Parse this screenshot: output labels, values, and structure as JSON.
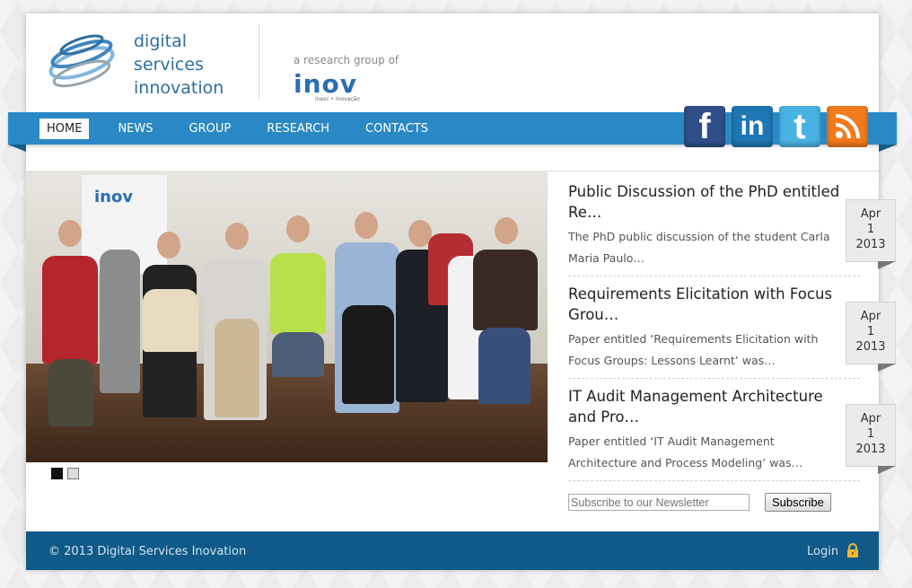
{
  "header": {
    "logo_lines": [
      "digital",
      "services",
      "innovation"
    ],
    "research_group_of": "a research group of",
    "partner_logo_main": "inov",
    "partner_logo_sub": "inesc • inovação"
  },
  "nav": {
    "items": [
      {
        "label": "HOME",
        "active": true
      },
      {
        "label": "NEWS",
        "active": false
      },
      {
        "label": "GROUP",
        "active": false
      },
      {
        "label": "RESEARCH",
        "active": false
      },
      {
        "label": "CONTACTS",
        "active": false
      }
    ]
  },
  "social": [
    {
      "name": "facebook-icon",
      "glyph": "f",
      "color": "#2e4f8a"
    },
    {
      "name": "linkedin-icon",
      "glyph": "in",
      "color": "#1e77b4"
    },
    {
      "name": "twitter-icon",
      "glyph": "t",
      "color": "#49b3e3"
    },
    {
      "name": "rss-icon",
      "glyph": "rss",
      "color": "#f27b1d"
    }
  ],
  "slider": {
    "banner_text": "inov",
    "dots": [
      true,
      false
    ]
  },
  "news": [
    {
      "title": "Public Discussion of the PhD entitled Re…",
      "excerpt": "The PhD public discussion of the student Carla Maria Paulo…",
      "date": {
        "month": "Apr",
        "day": "1",
        "year": "2013"
      }
    },
    {
      "title": "Requirements Elicitation with Focus Grou…",
      "excerpt": "Paper entitled ‘Requirements Elicitation with Focus Groups: Lessons Learnt’ was…",
      "date": {
        "month": "Apr",
        "day": "1",
        "year": "2013"
      }
    },
    {
      "title": "IT Audit Management Architecture and Pro…",
      "excerpt": "Paper entitled ‘IT Audit Management Architecture and Process Modeling’ was…",
      "date": {
        "month": "Apr",
        "day": "1",
        "year": "2013"
      }
    }
  ],
  "newsletter": {
    "placeholder": "Subscribe to our Newsletter",
    "button_label": "Subscribe"
  },
  "footer": {
    "copyright": "© 2013 Digital Services Inovation",
    "login_label": "Login"
  },
  "colors": {
    "nav_blue": "#2a89c5",
    "footer_blue": "#0f5a88",
    "logo_blue": "#2d6f9e"
  }
}
